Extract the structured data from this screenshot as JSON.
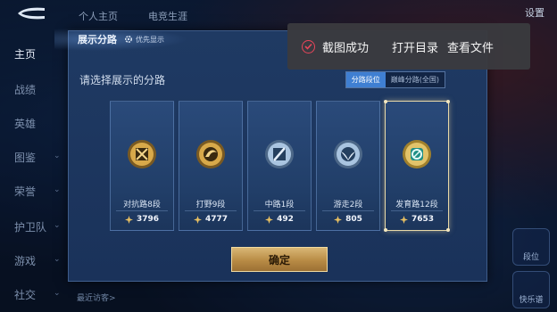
{
  "top_tabs": [
    "个人主页",
    "电竞生涯"
  ],
  "top_right": "设置",
  "nav": {
    "items": [
      {
        "label": "主页",
        "active": true
      },
      {
        "label": "战绩",
        "active": false
      },
      {
        "label": "英雄",
        "active": false
      },
      {
        "label": "图鉴",
        "active": false,
        "chevron": true
      },
      {
        "label": "荣誉",
        "active": false,
        "chevron": true
      },
      {
        "label": "护卫队",
        "active": false,
        "chevron": true
      },
      {
        "label": "游戏",
        "active": false,
        "chevron": true
      },
      {
        "label": "社交",
        "active": false,
        "chevron": true
      }
    ]
  },
  "dialog": {
    "title": "展示分路",
    "priority_label": "优先显示",
    "prompt": "请选择展示的分路",
    "seg_tabs": [
      {
        "label": "分路段位",
        "active": true
      },
      {
        "label": "巅峰分路(全国)",
        "active": false
      }
    ],
    "cards": [
      {
        "label": "对抗路8段",
        "score": "3796",
        "selected": false,
        "badge_color": "#c99a3a",
        "icon": "crossed-swords-icon"
      },
      {
        "label": "打野9段",
        "score": "4777",
        "selected": false,
        "badge_color": "#c99a3a",
        "icon": "claw-icon"
      },
      {
        "label": "中路1段",
        "score": "492",
        "selected": false,
        "badge_color": "#8fb4d8",
        "icon": "slash-icon"
      },
      {
        "label": "游走2段",
        "score": "805",
        "selected": false,
        "badge_color": "#8fb4d8",
        "icon": "wings-icon"
      },
      {
        "label": "发育路12段",
        "score": "7653",
        "selected": true,
        "badge_color": "#3fb9a6",
        "icon": "target-icon"
      }
    ],
    "confirm_label": "确定"
  },
  "toast": {
    "message": "截图成功",
    "open_dir": "打开目录",
    "view_file": "查看文件",
    "accent": "#e8465a"
  },
  "bottom": {
    "text": "最近访客>"
  },
  "right_buttons": [
    "段位",
    "快乐谱"
  ]
}
